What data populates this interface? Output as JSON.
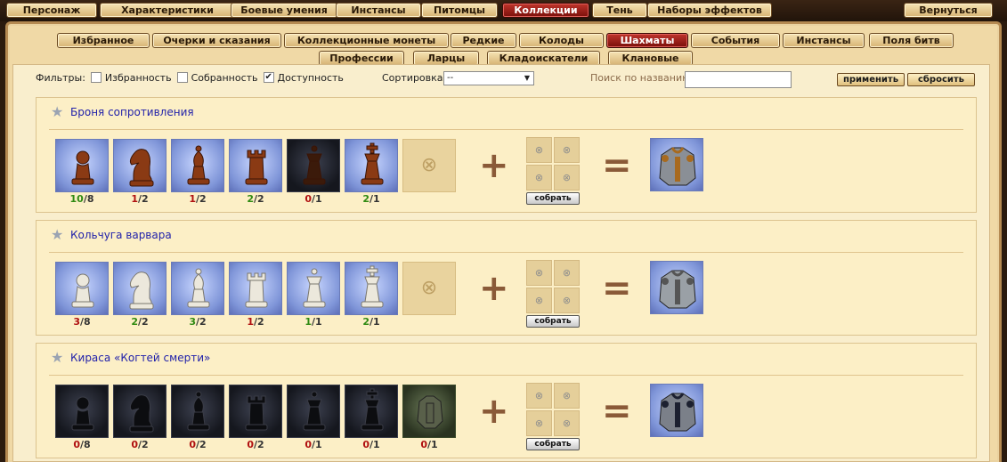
{
  "top_tabs": [
    {
      "label": "Персонаж",
      "active": false
    },
    {
      "label": "Характеристики",
      "active": false
    },
    {
      "label": "Боевые умения",
      "active": false
    },
    {
      "label": "Инстансы",
      "active": false
    },
    {
      "label": "Питомцы",
      "active": false
    },
    {
      "label": "Коллекции",
      "active": true
    },
    {
      "label": "Тень",
      "active": false
    },
    {
      "label": "Наборы эффектов",
      "active": false
    }
  ],
  "back_label": "Вернуться",
  "sub_tabs_row1": [
    {
      "label": "Избранное",
      "active": false
    },
    {
      "label": "Очерки и сказания",
      "active": false
    },
    {
      "label": "Коллекционные монеты",
      "active": false
    },
    {
      "label": "Редкие",
      "active": false
    },
    {
      "label": "Колоды",
      "active": false
    },
    {
      "label": "Шахматы",
      "active": true
    },
    {
      "label": "События",
      "active": false
    },
    {
      "label": "Инстансы",
      "active": false
    },
    {
      "label": "Поля битв",
      "active": false
    }
  ],
  "sub_tabs_row2": [
    {
      "label": "Профессии",
      "active": false
    },
    {
      "label": "Ларцы",
      "active": false
    },
    {
      "label": "Кладоискатели",
      "active": false
    },
    {
      "label": "Клановые",
      "active": false
    }
  ],
  "filters": {
    "label": "Фильтры:",
    "options": [
      {
        "label": "Избранность",
        "checked": false
      },
      {
        "label": "Собранность",
        "checked": false
      },
      {
        "label": "Доступность",
        "checked": true
      }
    ],
    "sort_label": "Сортировка:",
    "sort_value": "--",
    "search_label": "Поиск по названию:",
    "search_value": "",
    "apply_label": "применить",
    "reset_label": "сбросить"
  },
  "colors": {
    "accent": "#8f1410",
    "link": "#2222aa",
    "have": "#2f8a12",
    "lack": "#b01010"
  },
  "collections": [
    {
      "title": "Броня сопротивления",
      "piece_set": "bronze",
      "items": [
        {
          "piece": "pawn",
          "have": "10",
          "need": "8",
          "ok": true
        },
        {
          "piece": "knight",
          "have": "1",
          "need": "2",
          "ok": false
        },
        {
          "piece": "bishop",
          "have": "1",
          "need": "2",
          "ok": false
        },
        {
          "piece": "rook",
          "have": "2",
          "need": "2",
          "ok": true
        },
        {
          "piece": "queen",
          "have": "0",
          "need": "1",
          "ok": false,
          "dark": true
        },
        {
          "piece": "king",
          "have": "2",
          "need": "1",
          "ok": true
        }
      ],
      "collect_label": "собрать",
      "plus": "+",
      "equals": "=",
      "result_icon": "armor-bronze-icon"
    },
    {
      "title": "Кольчуга варвара",
      "piece_set": "white",
      "items": [
        {
          "piece": "pawn",
          "have": "3",
          "need": "8",
          "ok": false
        },
        {
          "piece": "knight",
          "have": "2",
          "need": "2",
          "ok": true
        },
        {
          "piece": "bishop",
          "have": "3",
          "need": "2",
          "ok": true
        },
        {
          "piece": "rook",
          "have": "1",
          "need": "2",
          "ok": false
        },
        {
          "piece": "queen",
          "have": "1",
          "need": "1",
          "ok": true
        },
        {
          "piece": "king",
          "have": "2",
          "need": "1",
          "ok": true
        }
      ],
      "collect_label": "собрать",
      "plus": "+",
      "equals": "=",
      "result_icon": "chainmail-icon"
    },
    {
      "title": "Кираса «Когтей смерти»",
      "piece_set": "black",
      "items": [
        {
          "piece": "pawn",
          "have": "0",
          "need": "8",
          "ok": false
        },
        {
          "piece": "knight",
          "have": "0",
          "need": "2",
          "ok": false
        },
        {
          "piece": "bishop",
          "have": "0",
          "need": "2",
          "ok": false
        },
        {
          "piece": "rook",
          "have": "0",
          "need": "2",
          "ok": false
        },
        {
          "piece": "queen",
          "have": "0",
          "need": "1",
          "ok": false
        },
        {
          "piece": "king",
          "have": "0",
          "need": "1",
          "ok": false
        },
        {
          "piece": "armor",
          "have": "0",
          "need": "1",
          "ok": false
        }
      ],
      "collect_label": "собрать",
      "plus": "+",
      "equals": "=",
      "result_icon": "cuirass-icon"
    }
  ]
}
